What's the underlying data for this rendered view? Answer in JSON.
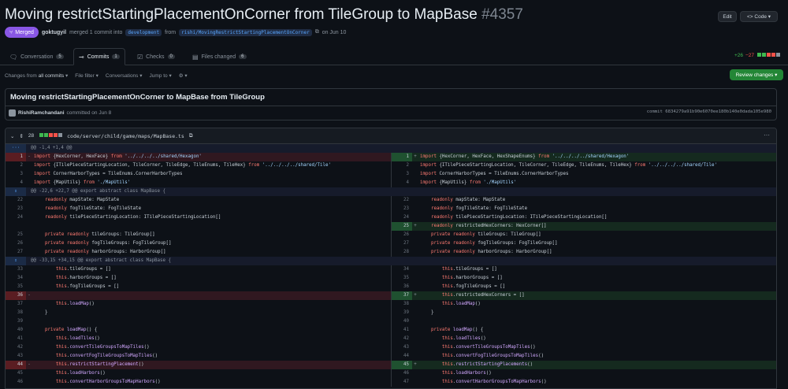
{
  "pr": {
    "title": "Moving restrictStartingPlacementOnCorner from TileGroup to MapBase",
    "number": "#4357",
    "edit_label": "Edit",
    "code_label": "Code",
    "status": "Merged",
    "author": "goktugyil",
    "merged_text": "merged 1 commit into",
    "base_branch": "development",
    "from_text": "from",
    "head_branch": "rishi/MovingRestrictStartingPlacementOnCorner",
    "date_text": "on Jun 10"
  },
  "tabs": [
    {
      "label": "Conversation",
      "count": "5",
      "icon": "comment-icon"
    },
    {
      "label": "Commits",
      "count": "1",
      "icon": "commit-icon"
    },
    {
      "label": "Checks",
      "count": "0",
      "icon": "checks-icon"
    },
    {
      "label": "Files changed",
      "count": "6",
      "icon": "file-diff-icon"
    }
  ],
  "diffstat": {
    "additions": "+26",
    "deletions": "−27"
  },
  "toolbar": {
    "changes_from": "Changes from",
    "all_commits": "all commits",
    "file_filter": "File filter",
    "conversations": "Conversations",
    "jump_to": "Jump to",
    "review_button": "Review changes"
  },
  "commit": {
    "title": "Moving restrictStartingPlacementOnCorner to MapBase from TileGroup",
    "author": "RishiRamchandani",
    "date_text": "committed on Jun 8",
    "hash": "commit 6834279a91b90e6070ee180b140e0dada105e980"
  },
  "file": {
    "changes": "28",
    "path": "code/server/child/game/maps/MapBase.ts"
  },
  "diff_rows": [
    {
      "type": "hunk",
      "text": "@@ -1,4 +1,4 @@"
    },
    {
      "type": "change",
      "l": "1",
      "lm": "-",
      "lc": "import {HexCorner, HexFace} from '../../../../shared/Hexagon'",
      "lk": "del",
      "r": "1",
      "rm": "+",
      "rc": "import {HexCorner, HexFace, HexShapeEnums} from '../../../../shared/Hexagon'",
      "rk": "add"
    },
    {
      "type": "ctx",
      "l": "2",
      "lc": "import {ITilePieceStartingLocation, TileCorner, TileEdge, TileEnums, TileHex} from '../../../../shared/Tile'",
      "r": "2",
      "rc": "import {ITilePieceStartingLocation, TileCorner, TileEdge, TileEnums, TileHex} from '../../../../shared/Tile'"
    },
    {
      "type": "ctx",
      "l": "3",
      "lc": "import CornerHarborTypes = TileEnums.CornerHarborTypes",
      "r": "3",
      "rc": "import CornerHarborTypes = TileEnums.CornerHarborTypes"
    },
    {
      "type": "ctx",
      "l": "4",
      "lc": "import {MapUtils} from './MapUtils'",
      "r": "4",
      "rc": "import {MapUtils} from './MapUtils'"
    },
    {
      "type": "hunk",
      "text": "@@ -22,6 +22,7 @@ export abstract class MapBase {"
    },
    {
      "type": "ctx",
      "l": "22",
      "lc": "    readonly mapState: MapState",
      "r": "22",
      "rc": "    readonly mapState: MapState"
    },
    {
      "type": "ctx",
      "l": "23",
      "lc": "    readonly fogTileState: FogTileState",
      "r": "23",
      "rc": "    readonly fogTileState: FogTileState"
    },
    {
      "type": "ctx",
      "l": "24",
      "lc": "    readonly tilePieceStartingLocation: ITilePieceStartingLocation[]",
      "r": "24",
      "rc": "    readonly tilePieceStartingLocation: ITilePieceStartingLocation[]"
    },
    {
      "type": "change",
      "l": "",
      "lm": "",
      "lc": "",
      "lk": "empty",
      "r": "25",
      "rm": "+",
      "rc": "    readonly restrictedHexCorners: HexCorner[]",
      "rk": "add"
    },
    {
      "type": "ctx",
      "l": "25",
      "lc": "    private readonly tileGroups: TileGroup[]",
      "r": "26",
      "rc": "    private readonly tileGroups: TileGroup[]"
    },
    {
      "type": "ctx",
      "l": "26",
      "lc": "    private readonly fogTileGroups: FogTileGroup[]",
      "r": "27",
      "rc": "    private readonly fogTileGroups: FogTileGroup[]"
    },
    {
      "type": "ctx",
      "l": "27",
      "lc": "    private readonly harborGroups: HarborGroup[]",
      "r": "28",
      "rc": "    private readonly harborGroups: HarborGroup[]"
    },
    {
      "type": "hunk",
      "text": "@@ -33,15 +34,15 @@ export abstract class MapBase {"
    },
    {
      "type": "ctx",
      "l": "33",
      "lc": "        this.tileGroups = []",
      "r": "34",
      "rc": "        this.tileGroups = []"
    },
    {
      "type": "ctx",
      "l": "34",
      "lc": "        this.harborGroups = []",
      "r": "35",
      "rc": "        this.harborGroups = []"
    },
    {
      "type": "ctx",
      "l": "35",
      "lc": "        this.fogTileGroups = []",
      "r": "36",
      "rc": "        this.fogTileGroups = []"
    },
    {
      "type": "change",
      "l": "36",
      "lm": "-",
      "lc": "",
      "lk": "del",
      "r": "37",
      "rm": "+",
      "rc": "        this.restrictedHexCorners = []",
      "rk": "add"
    },
    {
      "type": "ctx",
      "l": "37",
      "lc": "        this.loadMap()",
      "r": "38",
      "rc": "        this.loadMap()"
    },
    {
      "type": "ctx",
      "l": "38",
      "lc": "    }",
      "r": "39",
      "rc": "    }"
    },
    {
      "type": "ctx",
      "l": "39",
      "lc": "",
      "r": "40",
      "rc": ""
    },
    {
      "type": "ctx",
      "l": "40",
      "lc": "    private loadMap() {",
      "r": "41",
      "rc": "    private loadMap() {"
    },
    {
      "type": "ctx",
      "l": "41",
      "lc": "        this.loadTiles()",
      "r": "42",
      "rc": "        this.loadTiles()"
    },
    {
      "type": "ctx",
      "l": "42",
      "lc": "        this.convertTileGroupsToMapTiles()",
      "r": "43",
      "rc": "        this.convertTileGroupsToMapTiles()"
    },
    {
      "type": "ctx",
      "l": "43",
      "lc": "        this.convertFogTileGroupsToMapTiles()",
      "r": "44",
      "rc": "        this.convertFogTileGroupsToMapTiles()"
    },
    {
      "type": "change",
      "l": "44",
      "lm": "-",
      "lc": "        this.restrictStartingPlacement()",
      "lk": "del",
      "r": "45",
      "rm": "+",
      "rc": "        this.restrictStartingPlacements()",
      "rk": "add"
    },
    {
      "type": "ctx",
      "l": "45",
      "lc": "        this.loadHarbors()",
      "r": "46",
      "rc": "        this.loadHarbors()"
    },
    {
      "type": "ctx",
      "l": "46",
      "lc": "        this.convertHarborGroupsToMapHarbors()",
      "r": "47",
      "rc": "        this.convertHarborGroupsToMapHarbors()"
    }
  ],
  "colors": {
    "merged": "#8957e5",
    "review": "#238636",
    "add": "#3fb950",
    "del": "#f85149",
    "link": "#58a6ff"
  }
}
